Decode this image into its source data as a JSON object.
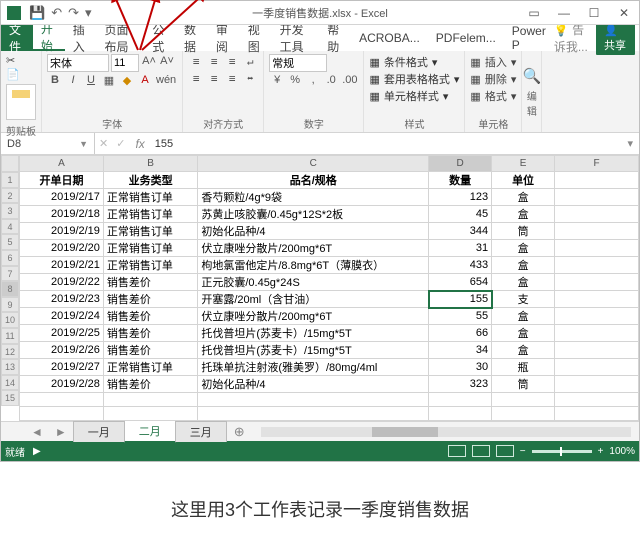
{
  "titlebar": {
    "title": "一季度销售数据.xlsx - Excel"
  },
  "menu": {
    "file": "文件",
    "home": "开始",
    "insert": "插入",
    "layout": "页面布局",
    "formula": "公式",
    "data": "数据",
    "review": "审阅",
    "view": "视图",
    "dev": "开发工具",
    "help": "帮助",
    "acr": "ACROBA...",
    "pdf": "PDFelem...",
    "pp": "Power P",
    "tell": "告诉我...",
    "share": "共享"
  },
  "ribbon": {
    "clipboard": "剪贴板",
    "font": "字体",
    "fontname": "宋体",
    "fontsize": "11",
    "align": "对齐方式",
    "number": "数字",
    "numfmt": "常规",
    "cond": "条件格式",
    "tablefmt": "套用表格格式",
    "cellstyle": "单元格样式",
    "styles": "样式",
    "cells": "单元格",
    "insertc": "插入",
    "deletec": "删除",
    "formatc": "格式",
    "edit": "编辑"
  },
  "namebox": {
    "ref": "D8",
    "formula": "155"
  },
  "cols": [
    "A",
    "B",
    "C",
    "D",
    "E",
    "F"
  ],
  "headers": {
    "A": "开单日期",
    "B": "业务类型",
    "C": "品名/规格",
    "D": "数量",
    "E": "单位"
  },
  "rows": [
    {
      "A": "2019/2/17",
      "B": "正常销售订单",
      "C": "香芍颗粒/4g*9袋",
      "D": "123",
      "E": "盒"
    },
    {
      "A": "2019/2/18",
      "B": "正常销售订单",
      "C": "苏黄止咳胶囊/0.45g*12S*2板",
      "D": "45",
      "E": "盒"
    },
    {
      "A": "2019/2/19",
      "B": "正常销售订单",
      "C": "初始化品种/4",
      "D": "344",
      "E": "筒"
    },
    {
      "A": "2019/2/20",
      "B": "正常销售订单",
      "C": "伏立康唑分散片/200mg*6T",
      "D": "31",
      "E": "盒"
    },
    {
      "A": "2019/2/21",
      "B": "正常销售订单",
      "C": "枸地氯雷他定片/8.8mg*6T（薄膜衣）",
      "D": "433",
      "E": "盒"
    },
    {
      "A": "2019/2/22",
      "B": "销售差价",
      "C": "正元胶囊/0.45g*24S",
      "D": "654",
      "E": "盒"
    },
    {
      "A": "2019/2/23",
      "B": "销售差价",
      "C": "开塞露/20ml（含甘油）",
      "D": "155",
      "E": "支"
    },
    {
      "A": "2019/2/24",
      "B": "销售差价",
      "C": "伏立康唑分散片/200mg*6T",
      "D": "55",
      "E": "盒"
    },
    {
      "A": "2019/2/25",
      "B": "销售差价",
      "C": "托伐普坦片(苏麦卡）/15mg*5T",
      "D": "66",
      "E": "盒"
    },
    {
      "A": "2019/2/26",
      "B": "销售差价",
      "C": "托伐普坦片(苏麦卡）/15mg*5T",
      "D": "34",
      "E": "盒"
    },
    {
      "A": "2019/2/27",
      "B": "正常销售订单",
      "C": "托珠单抗注射液(雅美罗）/80mg/4ml",
      "D": "30",
      "E": "瓶"
    },
    {
      "A": "2019/2/28",
      "B": "销售差价",
      "C": "初始化品种/4",
      "D": "323",
      "E": "筒"
    }
  ],
  "sheets": {
    "s1": "一月",
    "s2": "二月",
    "s3": "三月"
  },
  "status": {
    "ready": "就绪",
    "zoom": "100%"
  },
  "annotation": "这里用3个工作表记录一季度销售数据"
}
